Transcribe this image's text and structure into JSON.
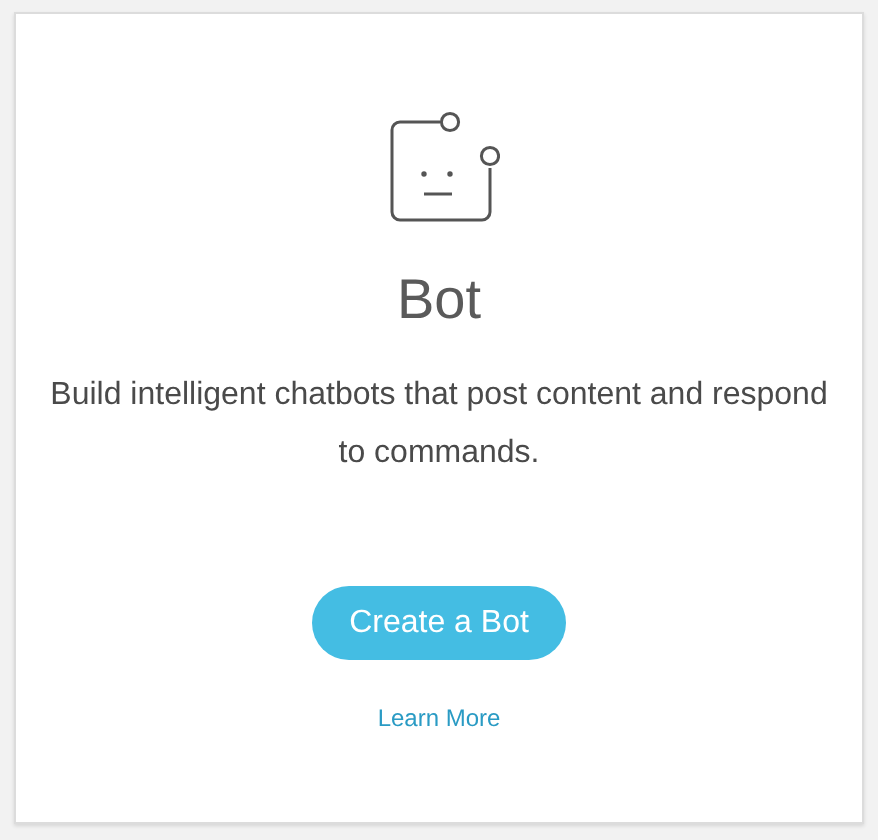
{
  "card": {
    "title": "Bot",
    "description": "Build intelligent chatbots that post content and respond to commands.",
    "button": "Create a Bot",
    "link": "Learn More"
  }
}
